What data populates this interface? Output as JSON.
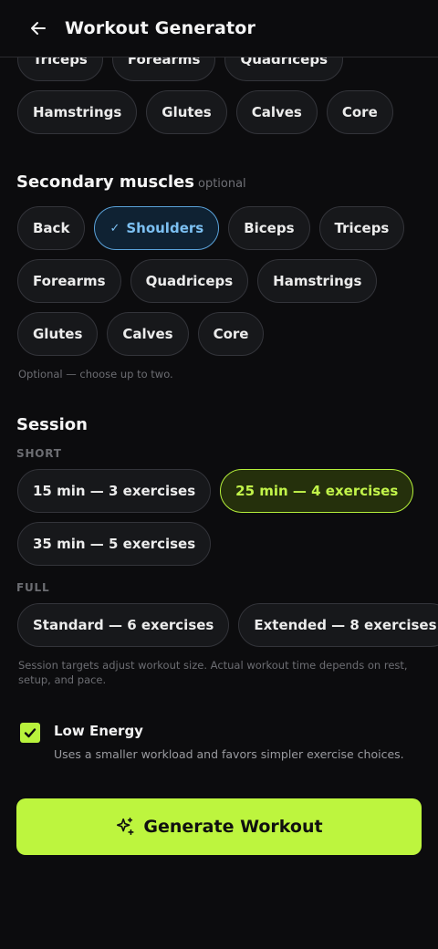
{
  "header": {
    "title": "Workout Generator"
  },
  "primary_muscles": {
    "row_partial": [
      "Triceps",
      "Forearms",
      "Quadriceps"
    ],
    "row_full": [
      "Hamstrings",
      "Glutes",
      "Calves",
      "Core"
    ]
  },
  "secondary": {
    "title": "Secondary muscles",
    "optional": "optional",
    "row1": [
      {
        "label": "Back",
        "selected": false
      },
      {
        "label": "Shoulders",
        "selected": true
      },
      {
        "label": "Biceps",
        "selected": false
      },
      {
        "label": "Triceps",
        "selected": false
      }
    ],
    "row2": [
      "Forearms",
      "Quadriceps",
      "Hamstrings"
    ],
    "row3": [
      "Glutes",
      "Calves",
      "Core"
    ],
    "hint": "Optional — choose up to two."
  },
  "session": {
    "title": "Session",
    "short_label": "SHORT",
    "short_row1": [
      {
        "label": "15 min — 3 exercises",
        "selected": false
      },
      {
        "label": "25 min — 4 exercises",
        "selected": true
      }
    ],
    "short_row2": [
      "35 min — 5 exercises"
    ],
    "full_label": "FULL",
    "full_row": [
      "Standard — 6 exercises",
      "Extended — 8 exercises"
    ],
    "hint": "Session targets adjust workout size. Actual workout time depends on rest, setup, and pace."
  },
  "low_energy": {
    "label": "Low Energy",
    "description": "Uses a smaller workload and favors simpler exercise choices.",
    "checked": true
  },
  "generate_button": {
    "label": "Generate Workout"
  },
  "colors": {
    "accent_lime": "#bdf53e",
    "selected_blue": "#5aa2d9",
    "background": "#0c0c0e"
  }
}
